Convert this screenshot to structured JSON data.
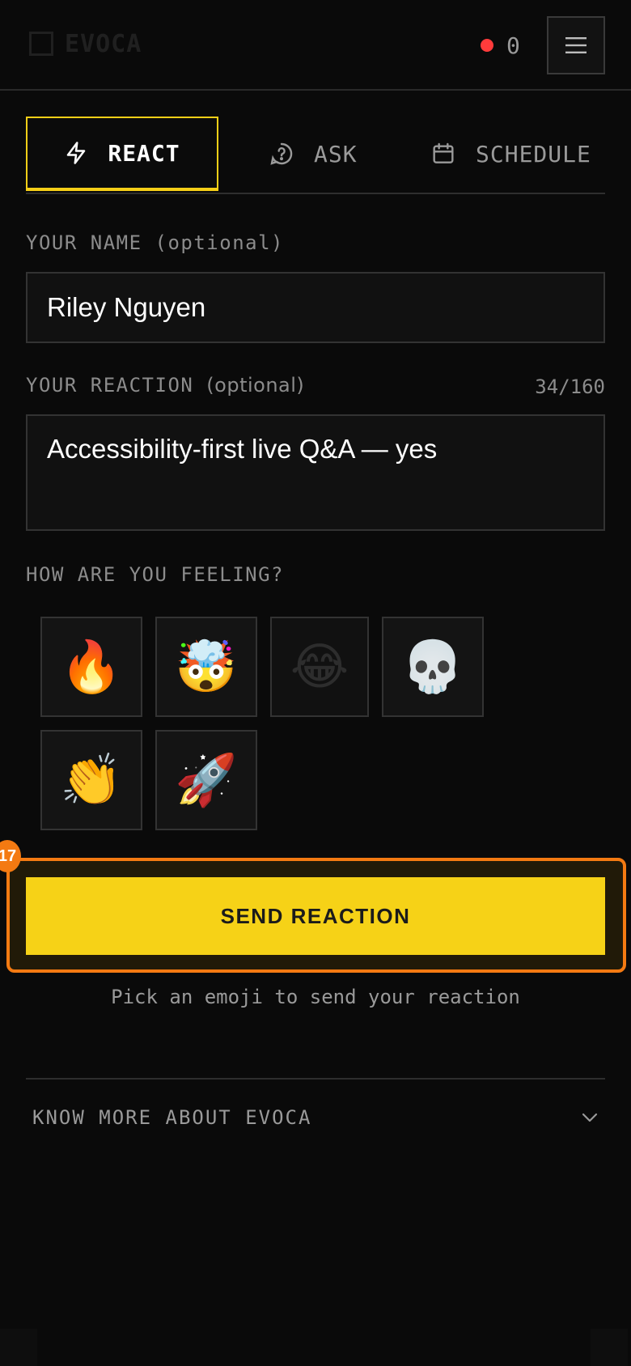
{
  "header": {
    "brand": "EVOCA",
    "live_count": "0",
    "menu_icon": "hamburger-icon",
    "live_color": "#ff3b3b"
  },
  "tabs": [
    {
      "label": "REACT",
      "icon": "lightning-icon",
      "active": true
    },
    {
      "label": "ASK",
      "icon": "question-circle-icon",
      "active": false
    },
    {
      "label": "SCHEDULE",
      "icon": "calendar-icon",
      "active": false
    }
  ],
  "form": {
    "name_label": "YOUR NAME",
    "name_optional": "(optional)",
    "name_value": "Riley Nguyen",
    "reaction_label": "YOUR REACTION",
    "reaction_optional": "(optional)",
    "reaction_counter": "34/160",
    "reaction_value": "Accessibility-first live Q&A — yes",
    "feeling_label": "HOW ARE YOU FEELING?"
  },
  "emojis": [
    "🔥",
    "🤯",
    "😂",
    "💀",
    "👏",
    "🚀"
  ],
  "send": {
    "label": "SEND REACTION",
    "badge": "17",
    "hint": "Pick an emoji to send your reaction"
  },
  "footer": {
    "know_more": "KNOW MORE ABOUT EVOCA"
  },
  "colors": {
    "accent": "#f6d217",
    "focus_ring": "#f47a12",
    "background": "#0a0a0a"
  }
}
